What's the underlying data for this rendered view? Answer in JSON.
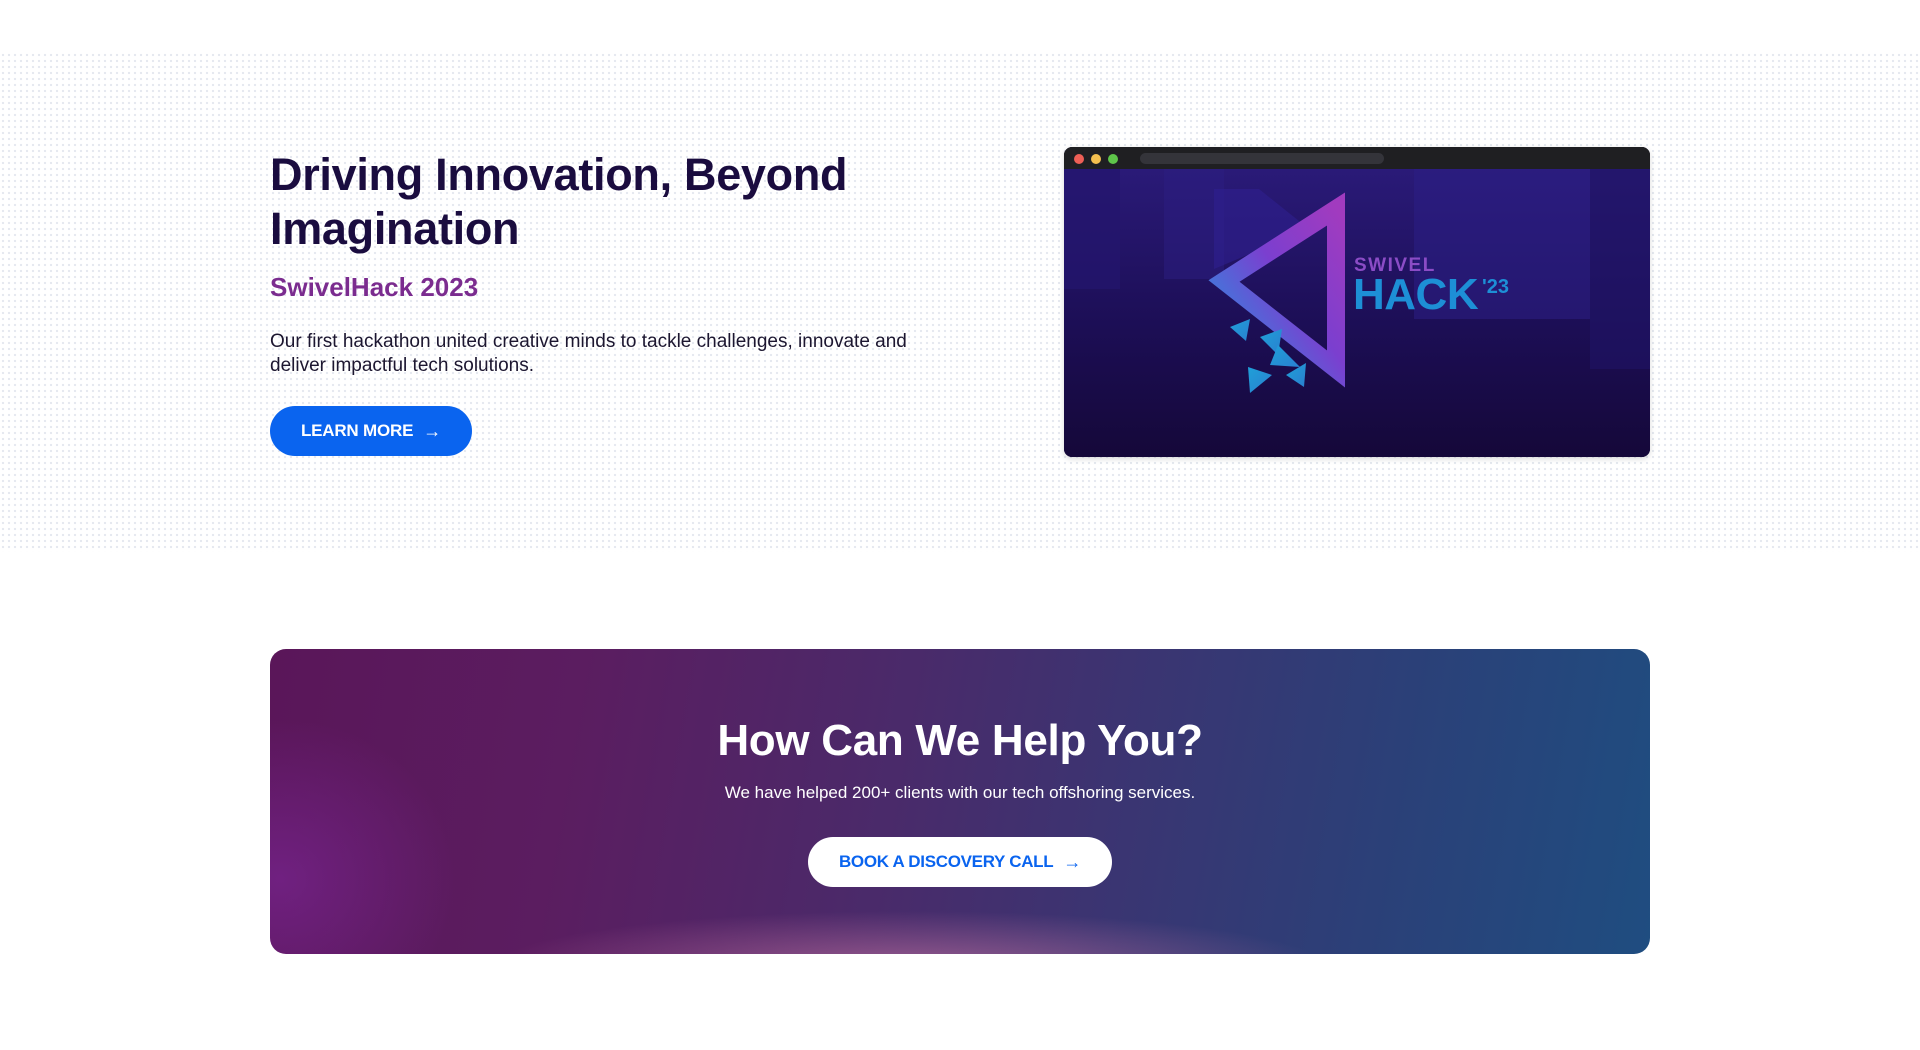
{
  "hero": {
    "title": "Driving Innovation, Beyond Imagination",
    "subtitle": "SwivelHack 2023",
    "description": "Our first hackathon united creative minds to tackle challenges, innovate and deliver impactful tech solutions.",
    "button_label": "LEARN MORE",
    "button_arrow": "→"
  },
  "preview": {
    "brand_small": "SWIVEL",
    "brand_large": "HACK",
    "brand_year": "'23",
    "icon": "swivelhack-logo-icon"
  },
  "cta": {
    "title": "How Can We Help You?",
    "description": "We have helped 200+ clients with our tech offshoring services.",
    "button_label": "BOOK A DISCOVERY CALL",
    "button_arrow": "→"
  },
  "colors": {
    "primary_blue": "#0a64ef",
    "title_dark": "#1a0c3f",
    "subtitle_purple": "#7b2c8f",
    "brand_purple": "#8b4cc6",
    "brand_blue": "#1d8fd6"
  }
}
